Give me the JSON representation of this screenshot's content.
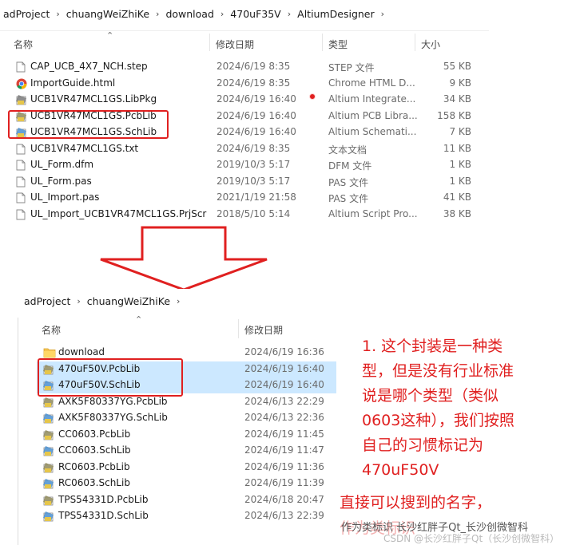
{
  "top_window": {
    "breadcrumb": [
      "adProject",
      "chuangWeiZhiKe",
      "download",
      "470uF35V",
      "AltiumDesigner"
    ],
    "columns": {
      "name": "名称",
      "date": "修改日期",
      "type": "类型",
      "size": "大小"
    },
    "files": [
      {
        "name": "CAP_UCB_4X7_NCH.step",
        "date": "2024/6/19 8:35",
        "type": "STEP 文件",
        "size": "55 KB",
        "icon": "step-file-icon"
      },
      {
        "name": "ImportGuide.html",
        "date": "2024/6/19 8:35",
        "type": "Chrome HTML D...",
        "size": "9 KB",
        "icon": "chrome-icon"
      },
      {
        "name": "UCB1VR47MCL1GS.LibPkg",
        "date": "2024/6/19 16:40",
        "type": "Altium Integrate...",
        "size": "34 KB",
        "icon": "libpkg-file-icon"
      },
      {
        "name": "UCB1VR47MCL1GS.PcbLib",
        "date": "2024/6/19 16:40",
        "type": "Altium PCB Libra...",
        "size": "158 KB",
        "icon": "pcblib-file-icon"
      },
      {
        "name": "UCB1VR47MCL1GS.SchLib",
        "date": "2024/6/19 16:40",
        "type": "Altium Schemati...",
        "size": "7 KB",
        "icon": "schlib-file-icon"
      },
      {
        "name": "UCB1VR47MCL1GS.txt",
        "date": "2024/6/19 8:35",
        "type": "文本文档",
        "size": "11 KB",
        "icon": "text-file-icon"
      },
      {
        "name": "UL_Form.dfm",
        "date": "2019/10/3 5:17",
        "type": "DFM 文件",
        "size": "1 KB",
        "icon": "file-icon"
      },
      {
        "name": "UL_Form.pas",
        "date": "2019/10/3 5:17",
        "type": "PAS 文件",
        "size": "1 KB",
        "icon": "file-icon"
      },
      {
        "name": "UL_Import.pas",
        "date": "2021/1/19 21:58",
        "type": "PAS 文件",
        "size": "41 KB",
        "icon": "file-icon"
      },
      {
        "name": "UL_Import_UCB1VR47MCL1GS.PrjScr",
        "date": "2018/5/10 5:14",
        "type": "Altium Script Pro...",
        "size": "38 KB",
        "icon": "file-icon"
      }
    ]
  },
  "bottom_window": {
    "breadcrumb": [
      "adProject",
      "chuangWeiZhiKe"
    ],
    "columns": {
      "name": "名称",
      "date": "修改日期"
    },
    "files": [
      {
        "name": "download",
        "date": "2024/6/19 16:36",
        "icon": "folder-icon",
        "selected": false
      },
      {
        "name": "470uF50V.PcbLib",
        "date": "2024/6/19 16:40",
        "icon": "pcblib-file-icon",
        "selected": true
      },
      {
        "name": "470uF50V.SchLib",
        "date": "2024/6/19 16:40",
        "icon": "schlib-file-icon",
        "selected": true
      },
      {
        "name": "AXK5F80337YG.PcbLib",
        "date": "2024/6/13 22:29",
        "icon": "pcblib-file-icon",
        "selected": false
      },
      {
        "name": "AXK5F80337YG.SchLib",
        "date": "2024/6/13 22:36",
        "icon": "schlib-file-icon",
        "selected": false
      },
      {
        "name": "CC0603.PcbLib",
        "date": "2024/6/19 11:45",
        "icon": "pcblib-file-icon",
        "selected": false
      },
      {
        "name": "CC0603.SchLib",
        "date": "2024/6/19 11:47",
        "icon": "schlib-file-icon",
        "selected": false
      },
      {
        "name": "RC0603.PcbLib",
        "date": "2024/6/19 11:36",
        "icon": "pcblib-file-icon",
        "selected": false
      },
      {
        "name": "RC0603.SchLib",
        "date": "2024/6/19 11:39",
        "icon": "schlib-file-icon",
        "selected": false
      },
      {
        "name": "TPS54331D.PcbLib",
        "date": "2024/6/18 20:47",
        "icon": "pcblib-file-icon",
        "selected": false
      },
      {
        "name": "TPS54331D.SchLib",
        "date": "2024/6/13 22:39",
        "icon": "schlib-file-icon",
        "selected": false
      }
    ]
  },
  "annotation": {
    "lines": [
      "1. 这个封装是一种类",
      "型，但是没有行业标准",
      "说是哪个类型（类似",
      "0603这种），我们按照",
      "自己的习惯标记为",
      "470uF50V"
    ],
    "line2": [
      "直接可以搜到的名字，",
      "作为类标识"
    ]
  },
  "watermark": {
    "text1": "作为类标识  长沙红胖子Qt_长沙创微智科",
    "text2": "CSDN @长沙红胖子Qt（长沙创微智科）"
  },
  "colors": {
    "accent_red": "#e02020",
    "selection": "#cce8ff"
  }
}
